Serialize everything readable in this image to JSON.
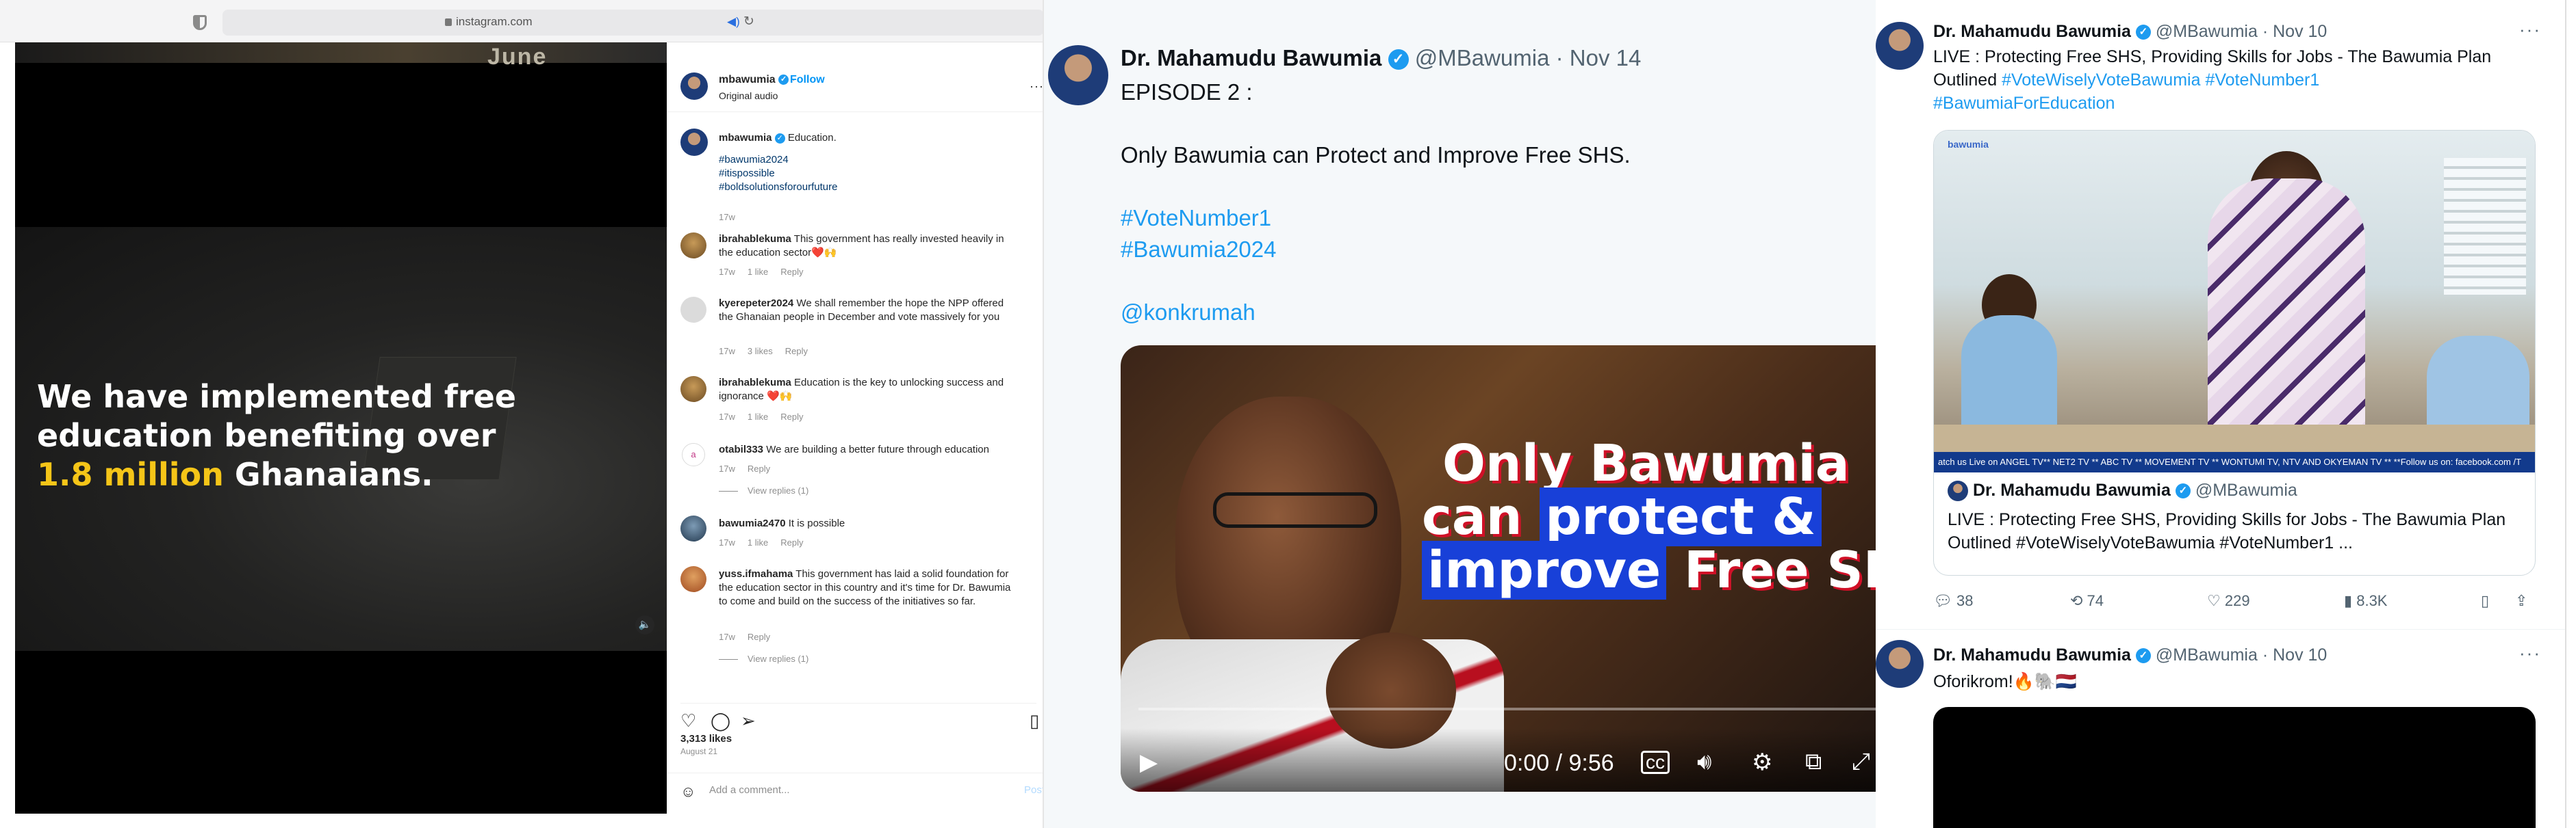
{
  "browser": {
    "url": "instagram.com"
  },
  "ig_video": {
    "top_text": "June",
    "caption_line1": "We have implemented free",
    "caption_line2": "education benefiting over",
    "caption_hl": "1.8 million",
    "caption_tail": " Ghanaians."
  },
  "instagram": {
    "username": "mbawumia",
    "follow": "Follow",
    "subtitle": "Original audio",
    "caption_user": "mbawumia",
    "caption_text": "Education.",
    "hashtags": [
      "#bawumia2024",
      "#itispossible",
      "#boldsolutionsforourfuture"
    ],
    "caption_age": "17w",
    "comments": [
      {
        "user": "ibrahablekuma",
        "text": "This government has really invested heavily in the education sector❤️🙌",
        "age": "17w",
        "likes": "1 like",
        "reply": "Reply"
      },
      {
        "user": "kyerepeter2024",
        "text": "We shall remember the hope the NPP offered the Ghanaian people in December and vote massively for you",
        "age": "17w",
        "likes": "3 likes",
        "reply": "Reply"
      },
      {
        "user": "ibrahablekuma",
        "text": "Education is the key to unlocking success and ignorance ❤️🙌",
        "age": "17w",
        "likes": "1 like",
        "reply": "Reply"
      },
      {
        "user": "otabil333",
        "text": "We are building a better future through education",
        "age": "17w",
        "likes": "",
        "reply": "Reply",
        "view_replies": "View replies (1)"
      },
      {
        "user": "bawumia2470",
        "text": "It is possible",
        "age": "17w",
        "likes": "1 like",
        "reply": "Reply"
      },
      {
        "user": "yuss.ifmahama",
        "text": "This government has laid a solid foundation for the education sector in this country and it's time for Dr. Bawumia to come and build on the success of the initiatives so far.",
        "age": "17w",
        "likes": "",
        "reply": "Reply",
        "view_replies": "View replies (1)"
      }
    ],
    "likes_count": "3,313 likes",
    "date": "August 21",
    "comment_placeholder": "Add a comment...",
    "post_label": "Post"
  },
  "tweet_main": {
    "name": "Dr. Mahamudu Bawumia",
    "handle": "@MBawumia",
    "date": "· Nov 14",
    "line1": "EPISODE 2 :",
    "line2": "Only Bawumia can Protect and Improve Free SHS.",
    "tag1": "#VoteNumber1",
    "tag2": "#Bawumia2024",
    "mention": "@konkrumah",
    "video_line1": "Only Bawumia",
    "video_line2a": "can ",
    "video_line2b": "protect &",
    "video_line3a": "improve",
    "video_line3b": " Free SHS",
    "time": "0:00 / 9:56"
  },
  "timeline": {
    "tweet1": {
      "name": "Dr. Mahamudu Bawumia",
      "handle": "@MBawumia",
      "date": "· Nov 10",
      "text": "LIVE : Protecting Free SHS, Providing Skills for Jobs - The Bawumia Plan Outlined ",
      "tag1": "#VoteWiselyVoteBawumia",
      "tag2": "#VoteNumber1",
      "tag3": "#BawumiaForEducation",
      "card_logo": "bawumia",
      "ticker": "atch us Live on ANGEL TV** NET2 TV ** ABC TV ** MOVEMENT TV ** WONTUMI TV, NTV AND OKYEMAN TV ** **Follow us on: facebook.com /T",
      "card_name": "Dr. Mahamudu Bawumia",
      "card_handle": "@MBawumia",
      "card_text": "LIVE : Protecting Free SHS, Providing Skills for Jobs - The Bawumia Plan Outlined #VoteWiselyVoteBawumia #VoteNumber1 ...",
      "replies": "38",
      "retweets": "74",
      "likes": "229",
      "views": "8.3K"
    },
    "tweet2": {
      "name": "Dr. Mahamudu Bawumia",
      "handle": "@MBawumia",
      "date": "· Nov 10",
      "text": "Oforikrom!🔥🐘🇳🇱"
    }
  },
  "colors": {
    "x_blue": "#1d9bf0",
    "ig_blue": "#0095f6",
    "highlight_yellow": "#f5c518"
  }
}
